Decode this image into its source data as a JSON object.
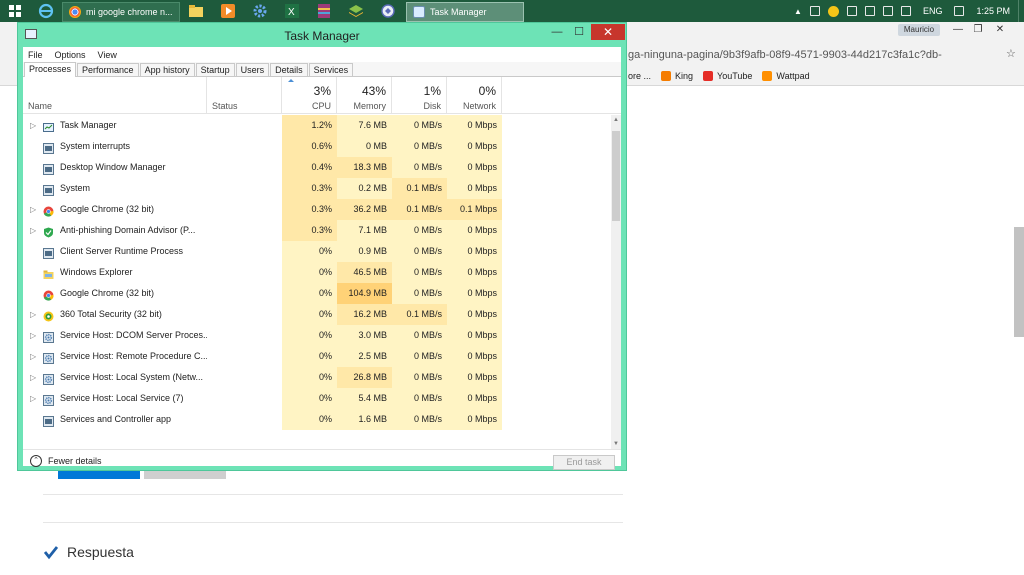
{
  "taskbar": {
    "chrome_task": "mi google chrome n...",
    "tm_task": "Task Manager",
    "lang": "ENG",
    "time": "1:25 PM"
  },
  "browser": {
    "user": "Mauricio",
    "url": "ga-ninguna-pagina/9b3f9afb-08f9-4571-9903-44d217c3fa1c?db-",
    "bookmarks": [
      {
        "label": "ore ..."
      },
      {
        "label": "King"
      },
      {
        "label": "YouTube"
      },
      {
        "label": "Wattpad"
      }
    ],
    "answer_heading": "Respuesta",
    "colors": {
      "accent": "#0078d7",
      "secondary_button": "#cfcfcf"
    }
  },
  "task_manager": {
    "title": "Task Manager",
    "menu": [
      "File",
      "Options",
      "View"
    ],
    "tabs": [
      "Processes",
      "Performance",
      "App history",
      "Startup",
      "Users",
      "Details",
      "Services"
    ],
    "active_tab": "Processes",
    "columns": {
      "name": "Name",
      "status": "Status",
      "cpu": {
        "pct": "3%",
        "label": "CPU"
      },
      "memory": {
        "pct": "43%",
        "label": "Memory"
      },
      "disk": {
        "pct": "1%",
        "label": "Disk"
      },
      "network": {
        "pct": "0%",
        "label": "Network"
      }
    },
    "rows": [
      {
        "name": "Task Manager",
        "expand": true,
        "icon": "taskmgr-icon",
        "cpu": "1.2%",
        "mem": "7.6 MB",
        "disk": "0 MB/s",
        "net": "0 Mbps",
        "h": 2
      },
      {
        "name": "System interrupts",
        "expand": false,
        "icon": "system-icon",
        "cpu": "0.6%",
        "mem": "0 MB",
        "disk": "0 MB/s",
        "net": "0 Mbps",
        "h": 2
      },
      {
        "name": "Desktop Window Manager",
        "expand": false,
        "icon": "system-icon",
        "cpu": "0.4%",
        "mem": "18.3 MB",
        "disk": "0 MB/s",
        "net": "0 Mbps",
        "h": 2
      },
      {
        "name": "System",
        "expand": false,
        "icon": "system-icon",
        "cpu": "0.3%",
        "mem": "0.2 MB",
        "disk": "0.1 MB/s",
        "net": "0 Mbps",
        "h": 2
      },
      {
        "name": "Google Chrome (32 bit)",
        "expand": true,
        "icon": "chrome-icon",
        "cpu": "0.3%",
        "mem": "36.2 MB",
        "disk": "0.1 MB/s",
        "net": "0.1 Mbps",
        "h": 2
      },
      {
        "name": "Anti-phishing Domain Advisor (P...",
        "expand": true,
        "icon": "shield-icon",
        "cpu": "0.3%",
        "mem": "7.1 MB",
        "disk": "0 MB/s",
        "net": "0 Mbps",
        "h": 2
      },
      {
        "name": "Client Server Runtime Process",
        "expand": false,
        "icon": "system-icon",
        "cpu": "0%",
        "mem": "0.9 MB",
        "disk": "0 MB/s",
        "net": "0 Mbps",
        "h": 1
      },
      {
        "name": "Windows Explorer",
        "expand": false,
        "icon": "explorer-icon",
        "cpu": "0%",
        "mem": "46.5 MB",
        "disk": "0 MB/s",
        "net": "0 Mbps",
        "h": 1
      },
      {
        "name": "Google Chrome (32 bit)",
        "expand": false,
        "icon": "chrome-icon",
        "cpu": "0%",
        "mem": "104.9 MB",
        "disk": "0 MB/s",
        "net": "0 Mbps",
        "h": 1
      },
      {
        "name": "360 Total Security (32 bit)",
        "expand": true,
        "icon": "security-360-icon",
        "cpu": "0%",
        "mem": "16.2 MB",
        "disk": "0.1 MB/s",
        "net": "0 Mbps",
        "h": 1
      },
      {
        "name": "Service Host: DCOM Server Proces...",
        "expand": true,
        "icon": "gear-icon",
        "cpu": "0%",
        "mem": "3.0 MB",
        "disk": "0 MB/s",
        "net": "0 Mbps",
        "h": 1
      },
      {
        "name": "Service Host: Remote Procedure C...",
        "expand": true,
        "icon": "gear-icon",
        "cpu": "0%",
        "mem": "2.5 MB",
        "disk": "0 MB/s",
        "net": "0 Mbps",
        "h": 1
      },
      {
        "name": "Service Host: Local System (Netw...",
        "expand": true,
        "icon": "gear-icon",
        "cpu": "0%",
        "mem": "26.8 MB",
        "disk": "0 MB/s",
        "net": "0 Mbps",
        "h": 1
      },
      {
        "name": "Service Host: Local Service (7)",
        "expand": true,
        "icon": "gear-icon",
        "cpu": "0%",
        "mem": "5.4 MB",
        "disk": "0 MB/s",
        "net": "0 Mbps",
        "h": 1
      },
      {
        "name": "Services and Controller app",
        "expand": false,
        "icon": "system-icon",
        "cpu": "0%",
        "mem": "1.6 MB",
        "disk": "0 MB/s",
        "net": "0 Mbps",
        "h": 1
      }
    ],
    "footer": {
      "fewer_details": "Fewer details",
      "end_task": "End task"
    },
    "colors": {
      "heat_low": "#fff4c4",
      "heat_mid": "#ffe8a8",
      "heat_high": "#ffd277",
      "frame": "#6de3b6",
      "close": "#c7362c"
    }
  }
}
